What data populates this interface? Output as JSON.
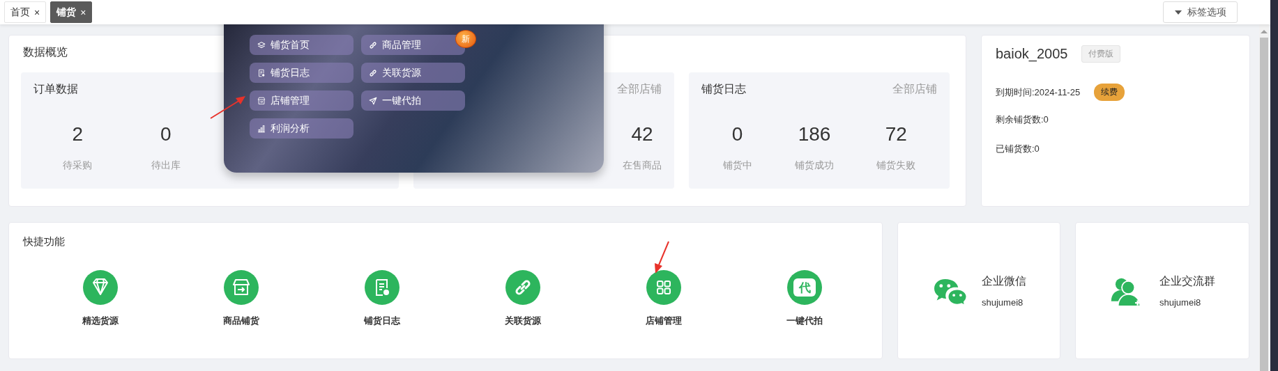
{
  "tabs": [
    {
      "label": "首页",
      "close": "×",
      "selected": false
    },
    {
      "label": "铺货",
      "close": "×",
      "selected": true
    }
  ],
  "tab_options_button": "标签选项",
  "overview": {
    "title": "数据概览",
    "panels": [
      {
        "title": "订单数据",
        "stats": [
          {
            "value": "2",
            "label": "待采购"
          },
          {
            "value": "0",
            "label": "待出库"
          }
        ]
      },
      {
        "scope": "全部店铺",
        "stats": [
          {
            "value": "42",
            "label": "在售商品"
          }
        ]
      },
      {
        "title": "铺货日志",
        "scope": "全部店铺",
        "stats": [
          {
            "value": "0",
            "label": "铺货中"
          },
          {
            "value": "186",
            "label": "铺货成功"
          },
          {
            "value": "72",
            "label": "铺货失败"
          }
        ]
      }
    ]
  },
  "account": {
    "username": "baiok_2005",
    "plan_badge": "付费版",
    "expiry": "到期时间:2024-11-25",
    "renew_button": "续费",
    "remaining": "剩余铺货数:0",
    "used": "已铺货数:0"
  },
  "quick_functions": {
    "title": "快捷功能",
    "items": [
      {
        "label": "精选货源"
      },
      {
        "label": "商品铺货"
      },
      {
        "label": "铺货日志"
      },
      {
        "label": "关联货源"
      },
      {
        "label": "店铺管理"
      },
      {
        "label": "一键代拍",
        "glyph": "代"
      }
    ]
  },
  "contacts": [
    {
      "title": "企业微信",
      "account": "shujumei8"
    },
    {
      "title": "企业交流群",
      "account": "shujumei8"
    }
  ],
  "popup_menu": {
    "items": [
      {
        "label": "铺货首页"
      },
      {
        "label": "商品管理",
        "badge": "新"
      },
      {
        "label": "铺货日志"
      },
      {
        "label": "关联货源"
      },
      {
        "label": "店铺管理"
      },
      {
        "label": "一键代拍"
      },
      {
        "label": "利润分析"
      }
    ]
  }
}
